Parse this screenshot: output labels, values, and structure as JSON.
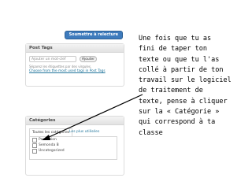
{
  "screenshot": {
    "submit_button": "Soumettre à relecture",
    "post_tags": {
      "title": "Post Tags",
      "input_placeholder": "Ajouter un mot-clef",
      "add_button": "Ajouter",
      "hint": "Séparez les étiquettes par des virgules.",
      "choose_link": "Choose from the most used tags in Post Tags"
    },
    "categories": {
      "title": "Catégories",
      "tab_all": "Toutes les catégories",
      "tab_used": "Les plus utilisées",
      "items": [
        {
          "label": "Promotion"
        },
        {
          "label": "Semonda B"
        },
        {
          "label": "Uncategorized"
        }
      ]
    }
  },
  "note_text": "Une fois que tu as\nfini de taper ton\ntexte ou que tu l'as\ncollé à partir de ton\ntravail sur le logiciel\nde  traitement de\ntexte, pense à cliquer\nsur la « Catégorie »\nqui correspond à ta\nclasse"
}
